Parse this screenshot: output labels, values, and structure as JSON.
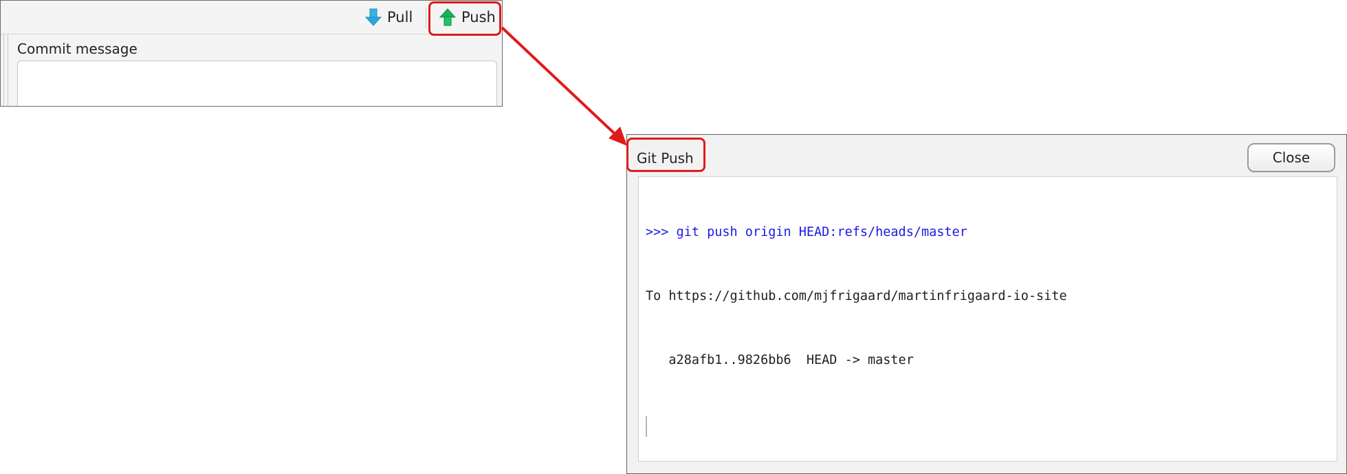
{
  "toolbar": {
    "pull_label": "Pull",
    "push_label": "Push",
    "pull_icon": "arrow-down-icon",
    "push_icon": "arrow-up-icon"
  },
  "commit": {
    "label": "Commit message",
    "value": ""
  },
  "dialog": {
    "title": "Git Push",
    "close_label": "Close",
    "console_lines": [
      {
        "kind": "command",
        "text": ">>> git push origin HEAD:refs/heads/master"
      },
      {
        "kind": "output",
        "text": "To https://github.com/mjfrigaard/martinfrigaard-io-site"
      },
      {
        "kind": "output",
        "text": "   a28afb1..9826bb6  HEAD -> master"
      }
    ]
  },
  "colors": {
    "highlight": "#e01a1a",
    "command_text": "#1a1ae6",
    "pull_arrow": "#2aa7d8",
    "push_arrow": "#19b35a"
  }
}
